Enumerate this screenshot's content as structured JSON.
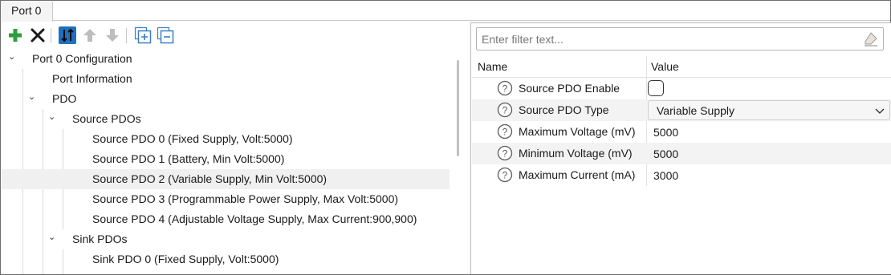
{
  "tabs": [
    {
      "label": "Port 0"
    }
  ],
  "toolbar": {
    "buttons": [
      {
        "name": "add-icon",
        "color": "#2e9e3e"
      },
      {
        "name": "delete-icon",
        "color": "#1a1a1a"
      },
      {
        "name": "sort-icon",
        "color": "#1f6fbf"
      },
      {
        "name": "move-up-icon",
        "color": "#bdbdbd"
      },
      {
        "name": "move-down-icon",
        "color": "#bdbdbd"
      },
      {
        "name": "expand-all-icon",
        "color": "#3a7fc6"
      },
      {
        "name": "collapse-all-icon",
        "color": "#3a7fc6"
      }
    ]
  },
  "tree": {
    "items": [
      {
        "label": "Port 0 Configuration",
        "level": 0,
        "expandable": true
      },
      {
        "label": "Port Information",
        "level": 1,
        "expandable": false
      },
      {
        "label": "PDO",
        "level": 1,
        "expandable": true
      },
      {
        "label": "Source PDOs",
        "level": 2,
        "expandable": true
      },
      {
        "label": "Source PDO 0 (Fixed Supply, Volt:5000)",
        "level": 3,
        "expandable": false
      },
      {
        "label": "Source PDO 1 (Battery, Min Volt:5000)",
        "level": 3,
        "expandable": false
      },
      {
        "label": "Source PDO 2 (Variable Supply, Min Volt:5000)",
        "level": 3,
        "expandable": false,
        "selected": true
      },
      {
        "label": "Source PDO 3 (Programmable Power Supply, Max Volt:5000)",
        "level": 3,
        "expandable": false
      },
      {
        "label": "Source PDO 4 (Adjustable Voltage Supply, Max Current:900,900)",
        "level": 3,
        "expandable": false
      },
      {
        "label": "Sink PDOs",
        "level": 2,
        "expandable": true
      },
      {
        "label": "Sink PDO 0 (Fixed Supply, Volt:5000)",
        "level": 3,
        "expandable": false
      }
    ]
  },
  "filter": {
    "placeholder": "Enter filter text..."
  },
  "properties": {
    "headers": {
      "name": "Name",
      "value": "Value"
    },
    "rows": [
      {
        "name": "Source PDO Enable",
        "type": "checkbox",
        "checked": false
      },
      {
        "name": "Source PDO Type",
        "type": "combo",
        "value": "Variable Supply"
      },
      {
        "name": "Maximum Voltage (mV)",
        "type": "text",
        "value": "5000"
      },
      {
        "name": "Minimum Voltage (mV)",
        "type": "text",
        "value": "5000"
      },
      {
        "name": "Maximum Current (mA)",
        "type": "text",
        "value": "3000"
      }
    ]
  }
}
